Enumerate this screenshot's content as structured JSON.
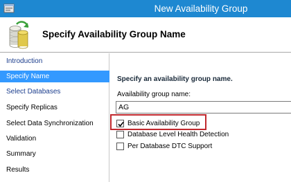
{
  "window": {
    "title": "New Availability Group"
  },
  "header": {
    "title": "Specify Availability Group Name"
  },
  "sidebar": {
    "items": [
      {
        "label": "Introduction"
      },
      {
        "label": "Specify Name"
      },
      {
        "label": "Select Databases"
      },
      {
        "label": "Specify Replicas"
      },
      {
        "label": "Select Data Synchronization"
      },
      {
        "label": "Validation"
      },
      {
        "label": "Summary"
      },
      {
        "label": "Results"
      }
    ],
    "selected": "Specify Name"
  },
  "main": {
    "prompt": "Specify an availability group name.",
    "name_field": {
      "label": "Availability group name:",
      "value": "AG"
    },
    "options": [
      {
        "label": "Basic Availability Group",
        "checked": true,
        "highlighted": true
      },
      {
        "label": "Database Level Health Detection",
        "checked": false
      },
      {
        "label": "Per Database DTC Support",
        "checked": false
      }
    ]
  },
  "colors": {
    "titlebar": "#1e88d1",
    "selected_nav": "#3399ff",
    "link_nav": "#1a3c8c",
    "highlight_box": "#c0282d"
  }
}
